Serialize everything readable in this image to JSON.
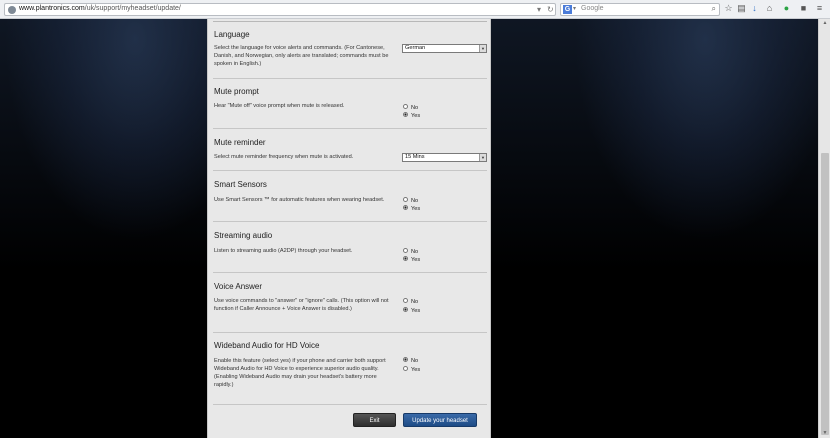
{
  "browser": {
    "url_domain": "www.plantronics.com",
    "url_path": "/uk/support/myheadset/update/",
    "search_placeholder": "Google",
    "search_engine_letter": "G"
  },
  "sections": [
    {
      "title": "Language",
      "desc": "Select the language for voice alerts and commands. (For Cantonese, Danish, and Norwegian, only alerts are translated; commands must be spoken in English.)",
      "control": "select",
      "value": "German"
    },
    {
      "title": "Mute prompt",
      "desc": "Hear \"Mute off\" voice prompt when mute is released.",
      "control": "radio",
      "options": [
        "No",
        "Yes"
      ],
      "selected": "Yes"
    },
    {
      "title": "Mute reminder",
      "desc": "Select mute reminder frequency when mute is activated.",
      "control": "select",
      "value": "15 Mins"
    },
    {
      "title": "Smart Sensors",
      "desc": "Use Smart Sensors ™ for automatic features when wearing headset.",
      "control": "radio",
      "options": [
        "No",
        "Yes"
      ],
      "selected": "Yes"
    },
    {
      "title": "Streaming audio",
      "desc": "Listen to streaming audio (A2DP) through your headset.",
      "control": "radio",
      "options": [
        "No",
        "Yes"
      ],
      "selected": "Yes"
    },
    {
      "title": "Voice Answer",
      "desc": "Use voice commands to \"answer\" or \"ignore\" calls. (This option will not function if Caller Announce + Voice Answer is disabled.)",
      "control": "radio",
      "options": [
        "No",
        "Yes"
      ],
      "selected": "Yes"
    },
    {
      "title": "Wideband Audio for HD Voice",
      "desc": "Enable this feature (select yes) if your phone and carrier both support Wideband Audio for HD Voice to experience superior audio quality. (Enabling Wideband Audio may drain your headset's battery more rapidly.)",
      "control": "radio",
      "options": [
        "No",
        "Yes"
      ],
      "selected": "No"
    }
  ],
  "buttons": {
    "exit": "Exit",
    "update": "Update your headset"
  }
}
